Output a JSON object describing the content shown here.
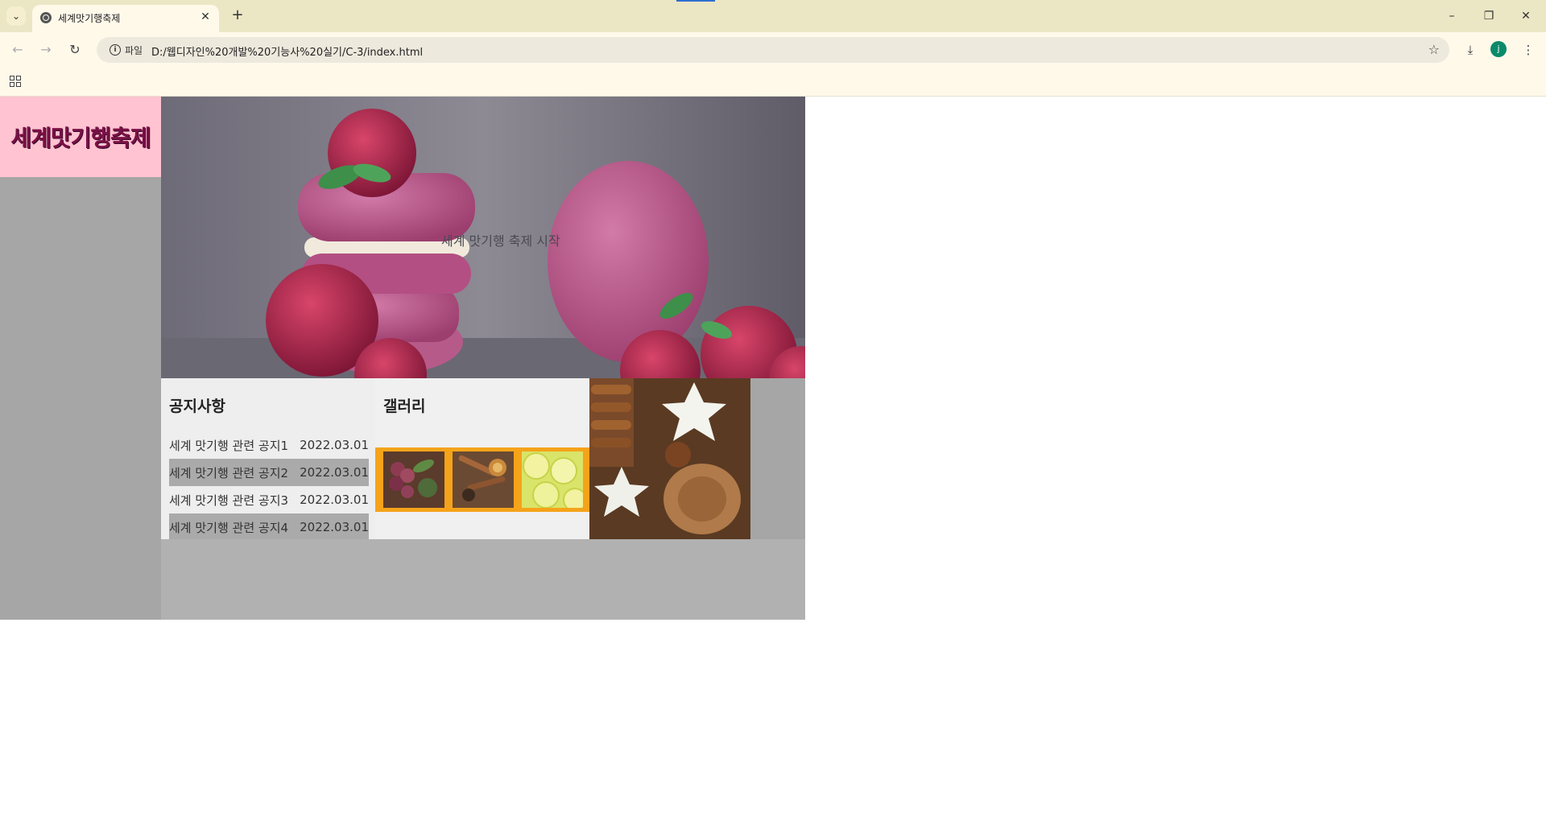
{
  "browser": {
    "tab_title": "세계맛기행축제",
    "site_info_label": "파일",
    "url": "D:/웹디자인%20개발%20기능사%20실기/C-3/index.html",
    "profile_initial": "j"
  },
  "site": {
    "logo": "세계맛기행축제",
    "banner_text": "세계 맛기행 축제 시작",
    "notice": {
      "title": "공지사항",
      "items": [
        {
          "title": "세계 맛기행 관련 공지1",
          "date": "2022.03.01"
        },
        {
          "title": "세계 맛기행 관련 공지2",
          "date": "2022.03.01"
        },
        {
          "title": "세계 맛기행 관련 공지3",
          "date": "2022.03.01"
        },
        {
          "title": "세계 맛기행 관련 공지4",
          "date": "2022.03.01"
        }
      ]
    },
    "gallery": {
      "title": "갤러리"
    }
  },
  "colors": {
    "tabbar_bg": "#ebe6c4",
    "toolbar_bg": "#fff9ea",
    "sidebar_bg": "#a6a6a6",
    "logo_bg": "#ffc3d1",
    "notice_row_alt": "#aaaaaa",
    "gallery_strip": "#f5a31a",
    "footer_bg": "#b1b1b1"
  }
}
